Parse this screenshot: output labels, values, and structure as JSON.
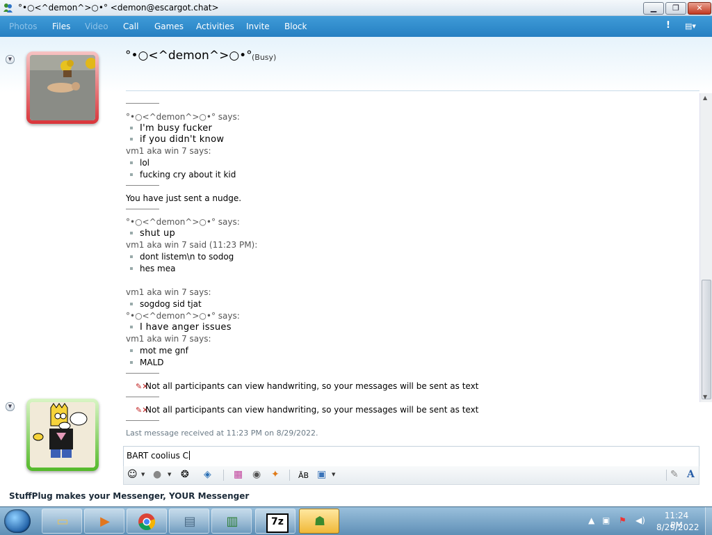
{
  "window": {
    "title": "°•○<^demon^>○•° <demon@escargot.chat>",
    "minimize_glyph": "▁",
    "maximize_glyph": "❐",
    "close_glyph": "✕"
  },
  "toolbar": {
    "items": [
      "Photos",
      "Files",
      "Video",
      "Call",
      "Games",
      "Activities",
      "Invite",
      "Block"
    ],
    "alert_glyph": "!",
    "options_glyph": "▤▾"
  },
  "contact": {
    "name": "°•○<^demon^>○•°",
    "status": "(Busy)"
  },
  "conversation": {
    "lines": [
      {
        "text": "°•○<^demon^>○•° says:"
      },
      {
        "text": "I'm busy fucker"
      },
      {
        "text": "if you didn't know"
      },
      {
        "text": "vm1 aka win 7 says:"
      },
      {
        "text": "lol"
      },
      {
        "text": "fucking cry about it kid"
      },
      {
        "text": "You have just sent a nudge."
      },
      {
        "text": "°•○<^demon^>○•° says:"
      },
      {
        "text": "shut up"
      },
      {
        "text": "vm1 aka win 7 said (11:23 PM):"
      },
      {
        "text": "dont listem\\n to sodog"
      },
      {
        "text": "hes mea"
      },
      {
        "text": "vm1 aka win 7 says:"
      },
      {
        "text": "sogdog sid tjat"
      },
      {
        "text": "°•○<^demon^>○•° says:"
      },
      {
        "text": "I have anger issues"
      },
      {
        "text": "vm1 aka win 7 says:"
      },
      {
        "text": "mot me gnf"
      },
      {
        "text": "MALD"
      },
      {
        "text": "Not all participants can view handwriting, so your messages will be sent as text"
      },
      {
        "text": "Not all participants can view handwriting, so your messages will be sent as text"
      }
    ],
    "last_received": "Last message received at 11:23 PM on 8/29/2022."
  },
  "input": {
    "value": "BART coolius C"
  },
  "input_toolbar": {
    "icons": [
      "emoticon-icon",
      "wink-icon",
      "nudge-icon",
      "voice-clip-icon",
      "background-icon",
      "ink-icon",
      "games-icon",
      "font-icon",
      "paste-icon",
      "handwriting-icon",
      "text-style-icon"
    ]
  },
  "footer": {
    "stuffplug": "StuffPlug makes your Messenger, YOUR Messenger"
  },
  "taskbar": {
    "apps": [
      "windows-explorer-icon",
      "media-player-icon",
      "chrome-icon",
      "window-icon",
      "task-manager-icon",
      "7zip-icon",
      "messenger-icon"
    ],
    "clock_time": "11:24 PM",
    "clock_date": "8/29/2022"
  },
  "colors": {
    "toolbar": "#2b86c8",
    "busy_frame": "#d9343a",
    "online_frame": "#54b92a",
    "taskbar": "#6f9cc1"
  }
}
